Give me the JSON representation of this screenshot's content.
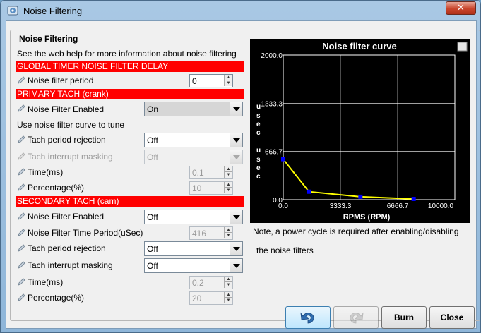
{
  "window": {
    "title": "Noise Filtering"
  },
  "group": {
    "title": "Noise Filtering",
    "help_text": "See the web help for more information about noise filtering"
  },
  "global": {
    "header": "GLOBAL TIMER NOISE FILTER DELAY",
    "period_label": "Noise filter period",
    "period_value": "0"
  },
  "primary": {
    "header": "PRIMARY TACH (crank)",
    "enabled_label": "Noise Filter Enabled",
    "enabled_value": "On",
    "curve_note": "Use noise filter curve to tune",
    "period_rejection_label": "Tach period rejection",
    "period_rejection_value": "Off",
    "interrupt_masking_label": "Tach interrupt masking",
    "interrupt_masking_value": "Off",
    "time_label": "Time(ms)",
    "time_value": "0.1",
    "percentage_label": "Percentage(%)",
    "percentage_value": "10"
  },
  "secondary": {
    "header": "SECONDARY TACH (cam)",
    "enabled_label": "Noise Filter Enabled",
    "enabled_value": "Off",
    "time_period_label": "Noise Filter Time Period(uSec)",
    "time_period_value": "416",
    "period_rejection_label": "Tach period rejection",
    "period_rejection_value": "Off",
    "interrupt_masking_label": "Tach interrupt masking",
    "interrupt_masking_value": "Off",
    "time_label": "Time(ms)",
    "time_value": "0.2",
    "percentage_label": "Percentage(%)",
    "percentage_value": "20"
  },
  "chart_data": {
    "type": "line",
    "title": "Noise filter curve",
    "xlabel": "RPMS (RPM)",
    "ylabel": "usec",
    "xlim": [
      0,
      10000
    ],
    "ylim": [
      0,
      2000
    ],
    "x_ticks": [
      "0.0",
      "3333.3",
      "6666.7",
      "10000.0"
    ],
    "y_ticks": [
      "0.0",
      "666.7",
      "1333.3",
      "2000.0"
    ],
    "grid": true,
    "series": [
      {
        "x": [
          0,
          1500,
          4500,
          7600
        ],
        "y": [
          560,
          110,
          40,
          10
        ],
        "color": "#ffff00",
        "marker_color": "#0000ff"
      }
    ],
    "menu_label": "..."
  },
  "note": {
    "line1": "Note, a power cycle is required after enabling/disabling",
    "line2": "the noise filters"
  },
  "buttons": {
    "burn": "Burn",
    "close": "Close"
  }
}
